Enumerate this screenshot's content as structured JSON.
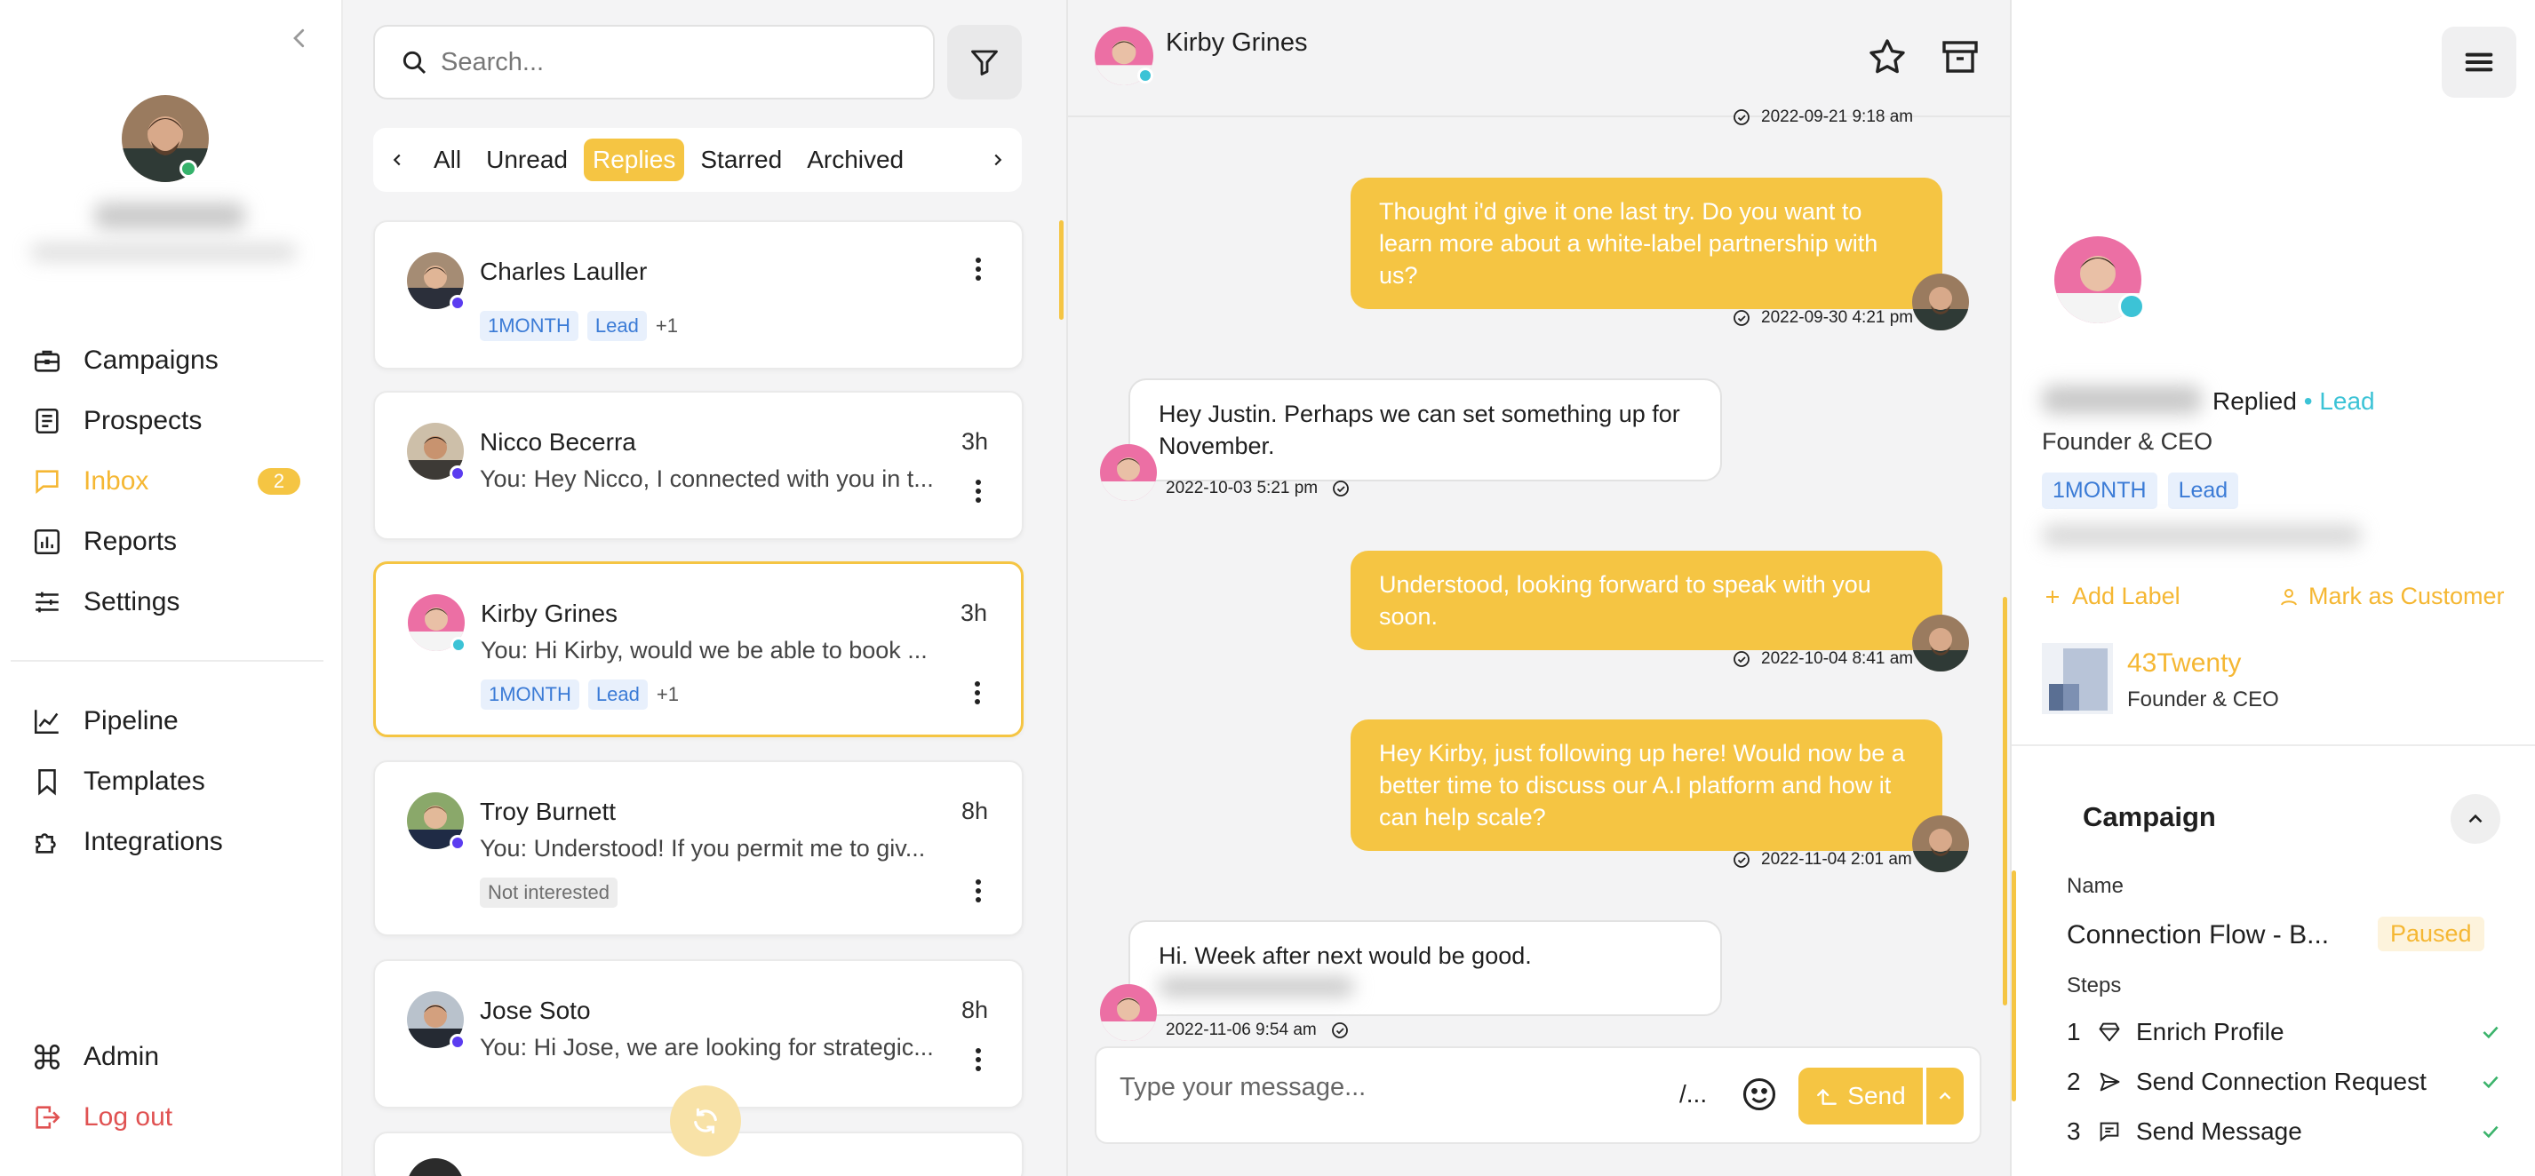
{
  "nav": {
    "items": [
      {
        "label": "Campaigns",
        "icon": "briefcase-icon"
      },
      {
        "label": "Prospects",
        "icon": "document-list-icon"
      },
      {
        "label": "Inbox",
        "icon": "message-icon",
        "badge": "2"
      },
      {
        "label": "Reports",
        "icon": "bar-chart-icon"
      },
      {
        "label": "Settings",
        "icon": "sliders-icon"
      },
      {
        "label": "Pipeline",
        "icon": "line-chart-icon"
      },
      {
        "label": "Templates",
        "icon": "bookmark-icon"
      },
      {
        "label": "Integrations",
        "icon": "puzzle-icon"
      }
    ],
    "admin": "Admin",
    "logout": "Log out"
  },
  "list": {
    "search_placeholder": "Search...",
    "tabs": [
      "All",
      "Unread",
      "Replies",
      "Starred",
      "Archived"
    ],
    "active_tab": "Replies",
    "conversations": [
      {
        "name": "Charles Lauller",
        "time": "",
        "preview": "",
        "labels": [
          "1MONTH",
          "Lead"
        ],
        "extra": "+1"
      },
      {
        "name": "Nicco Becerra",
        "time": "3h",
        "preview": "You: Hey Nicco, I connected with you in t...",
        "labels": [],
        "extra": ""
      },
      {
        "name": "Kirby Grines",
        "time": "3h",
        "preview": "You: Hi Kirby, would we be able to book ...",
        "labels": [
          "1MONTH",
          "Lead"
        ],
        "extra": "+1"
      },
      {
        "name": "Troy Burnett",
        "time": "8h",
        "preview": "You: Understood! If you permit me to giv...",
        "labels": [
          "Not interested"
        ],
        "extra": ""
      },
      {
        "name": "Jose Soto",
        "time": "8h",
        "preview": "You: Hi Jose, we are looking for strategic...",
        "labels": [],
        "extra": ""
      }
    ]
  },
  "chat": {
    "contact_name": "Kirby Grines",
    "top_stamp": "2022-09-21 9:18 am",
    "messages": [
      {
        "dir": "out",
        "text": "Thought i'd give it one last try. Do you want to learn more about a white-label partnership with us?",
        "time": "2022-09-30 4:21 pm"
      },
      {
        "dir": "in",
        "text": "Hey Justin. Perhaps we can set something up for November.",
        "time": "2022-10-03 5:21 pm"
      },
      {
        "dir": "out",
        "text": "Understood, looking forward to speak with you soon.",
        "time": "2022-10-04 8:41 am"
      },
      {
        "dir": "out",
        "text": "Hey Kirby, just following up here! Would now be a better time to discuss our A.I platform and how it can help scale?",
        "time": "2022-11-04 2:01 am"
      },
      {
        "dir": "in",
        "text": "Hi. Week after next would be good.",
        "time": "2022-11-06 9:54 am"
      }
    ],
    "composer_placeholder": "Type your message...",
    "slash": "/...",
    "send_label": "Send"
  },
  "profile": {
    "status": "Replied",
    "separator": "•",
    "stage": "Lead",
    "title": "Founder & CEO",
    "labels": [
      "1MONTH",
      "Lead"
    ],
    "add_label": "Add Label",
    "mark_customer": "Mark as Customer",
    "company": {
      "name": "43Twenty",
      "title": "Founder & CEO"
    },
    "campaign": {
      "heading": "Campaign",
      "name_label": "Name",
      "name": "Connection Flow - B...",
      "status": "Paused",
      "steps_label": "Steps",
      "steps": [
        {
          "num": "1",
          "label": "Enrich Profile",
          "icon": "diamond-icon"
        },
        {
          "num": "2",
          "label": "Send Connection Request",
          "icon": "send-icon"
        },
        {
          "num": "3",
          "label": "Send Message",
          "icon": "message-icon"
        }
      ]
    }
  },
  "colors": {
    "accent": "#f5c543",
    "accent_text": "#f5b733",
    "lead": "#3cc3d6",
    "label_blue": "#3b7bd6",
    "logout": "#e05252"
  }
}
